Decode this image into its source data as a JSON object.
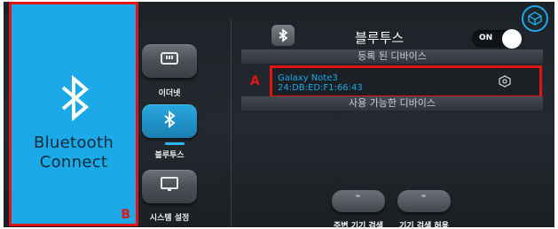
{
  "left_panel": {
    "app_name_line1": "Bluetooth",
    "app_name_line2": "Connect",
    "annotation": "B",
    "colors": {
      "panel": "#1ca9e8",
      "highlight": "#e01414"
    }
  },
  "nav": {
    "items": [
      {
        "label": "이더넷",
        "icon": "ethernet-icon"
      },
      {
        "label": "블루투스",
        "icon": "bluetooth-icon",
        "active": true
      },
      {
        "label": "시스템 설정",
        "icon": "monitor-icon"
      }
    ]
  },
  "header": {
    "title": "블루투스",
    "toggle_label": "ON",
    "toggle_on": true
  },
  "registered": {
    "section_title": "등록 된 디바이스",
    "devices": [
      {
        "name": "Galaxy Note3",
        "mac": "24:DB:ED:F1:66:43"
      }
    ],
    "annotation": "A"
  },
  "available": {
    "section_title": "사용 가능한 디바이스"
  },
  "actions": {
    "scan_label": "주변 기기 검색",
    "allow_label": "기기 검색 허용"
  }
}
